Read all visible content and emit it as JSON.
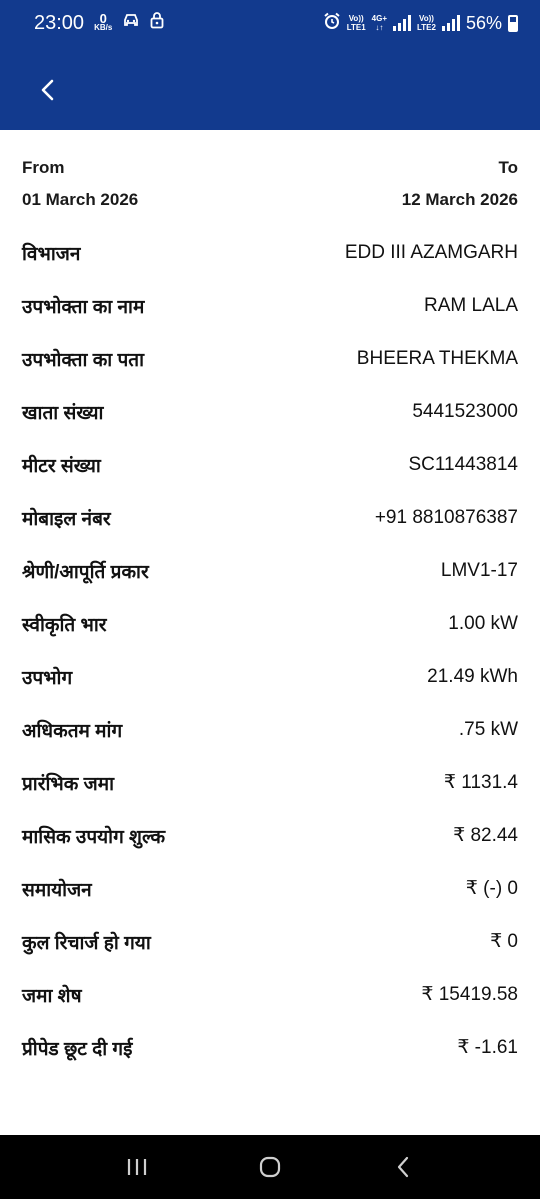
{
  "status_bar": {
    "time": "23:00",
    "net_speed": "0",
    "net_unit": "KB/s",
    "sim1_label_top": "Vo))",
    "sim1_label_bottom": "LTE1",
    "net_type_top": "4G+",
    "net_type_bottom": "↓↑",
    "sim2_label_top": "Vo))",
    "sim2_label_bottom": "LTE2",
    "battery": "56%"
  },
  "header": {
    "back_icon": "chevron-left-icon",
    "bg_color": "#123a8e"
  },
  "date_range": {
    "from_label": "From",
    "from_value": "01 March 2026",
    "to_label": "To",
    "to_value": "12 March 2026"
  },
  "details": [
    {
      "label": "विभाजन",
      "value": "EDD III AZAMGARH"
    },
    {
      "label": "उपभोक्ता का नाम",
      "value": "RAM LALA"
    },
    {
      "label": "उपभोक्ता का पता",
      "value": "BHEERA THEKMA"
    },
    {
      "label": "खाता संख्या",
      "value": "5441523000"
    },
    {
      "label": "मीटर संख्या",
      "value": "SC11443814"
    },
    {
      "label": "मोबाइल नंबर",
      "value": "+91 8810876387"
    },
    {
      "label": "श्रेणी/आपूर्ति प्रकार",
      "value": "LMV1-17"
    },
    {
      "label": "स्वीकृति भार",
      "value": "1.00 kW"
    },
    {
      "label": "उपभोग",
      "value": "21.49 kWh"
    },
    {
      "label": "अधिकतम मांग",
      "value": ".75 kW"
    },
    {
      "label": "प्रारंभिक जमा",
      "value": "₹ 1131.4"
    },
    {
      "label": "मासिक उपयोग शुल्क",
      "value": "₹ 82.44"
    },
    {
      "label": "समायोजन",
      "value": "₹ (-) 0"
    },
    {
      "label": "कुल रिचार्ज हो गया",
      "value": "₹ 0"
    },
    {
      "label": "जमा शेष",
      "value": "₹ 15419.58"
    },
    {
      "label": "प्रीपेड छूट दी गई",
      "value": "₹ -1.61"
    }
  ],
  "nav": {
    "recent_icon": "recent-apps-icon",
    "home_icon": "home-icon",
    "back_icon": "back-icon"
  }
}
